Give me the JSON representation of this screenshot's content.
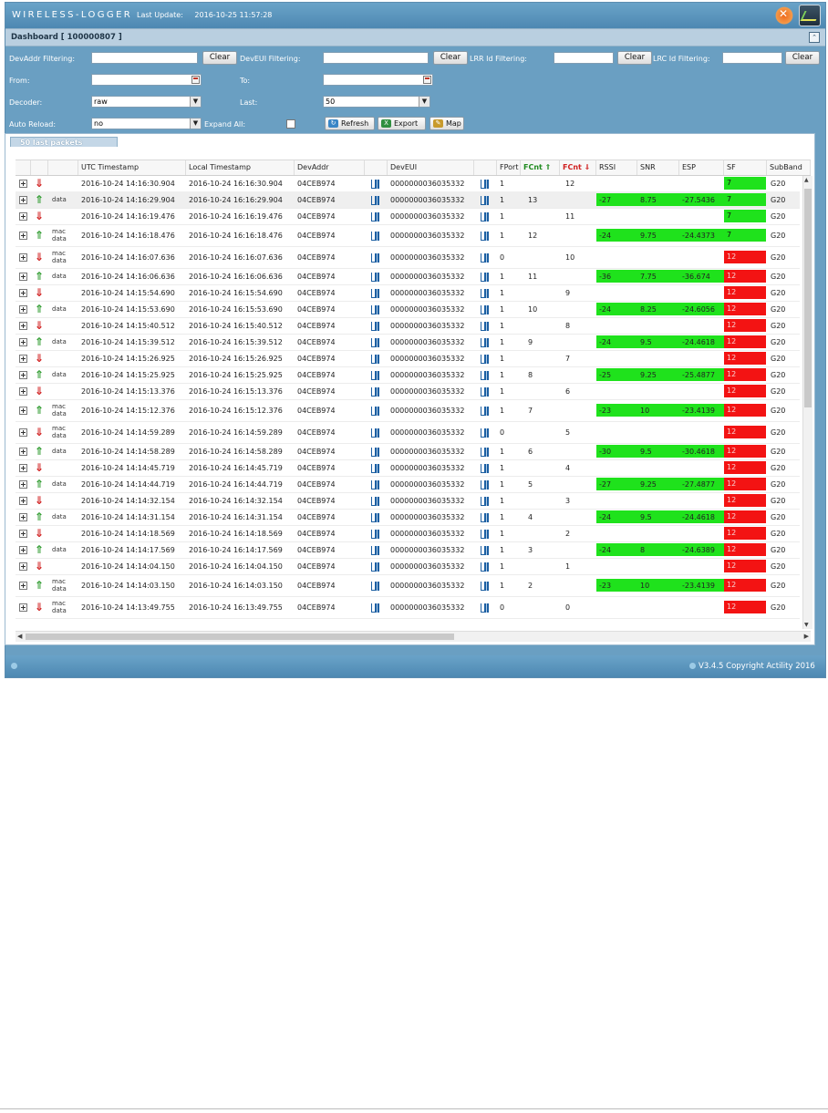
{
  "header": {
    "logo": "WIRELESS-LOGGER",
    "last_update_label": "Last Update:",
    "last_update_value": "2016-10-25 11:57:28"
  },
  "dashboard": {
    "title": "Dashboard [ 100000807 ]"
  },
  "filters": {
    "devaddr_label": "DevAddr Filtering:",
    "deveui_label": "DevEUI Filtering:",
    "lrr_label": "LRR Id Filtering:",
    "lrc_label": "LRC Id Filtering:",
    "clear_label": "Clear",
    "from_label": "From:",
    "to_label": "To:",
    "decoder_label": "Decoder:",
    "decoder_value": "raw",
    "last_label": "Last:",
    "last_value": "50",
    "autoreload_label": "Auto Reload:",
    "autoreload_value": "no",
    "expandall_label": "Expand All:",
    "refresh_label": "Refresh",
    "export_label": "Export",
    "map_label": "Map"
  },
  "panel": {
    "title": "50 last packets"
  },
  "columns": {
    "utc": "UTC Timestamp",
    "local": "Local Timestamp",
    "devaddr": "DevAddr",
    "deveui": "DevEUI",
    "fport": "FPort",
    "fcnt_up": "FCnt ⇑",
    "fcnt_dn": "FCnt ⇓",
    "rssi": "RSSI",
    "snr": "SNR",
    "esp": "ESP",
    "sf": "SF",
    "subband": "SubBand"
  },
  "colors": {
    "up_arrow": "#2e9b2e",
    "down_arrow": "#d01f1f",
    "good": "#1fe21c",
    "bad": "#f31313"
  },
  "rows": [
    {
      "dir": "down",
      "type": "",
      "utc": "2016-10-24 14:16:30.904",
      "local": "2016-10-24 16:16:30.904",
      "devaddr": "04CEB974",
      "deveui": "0000000036035332",
      "fport": "1",
      "fcnt_up": "",
      "fcnt_dn": "12",
      "rssi": "",
      "snr": "",
      "esp": "",
      "sf": "7",
      "subband": "G20"
    },
    {
      "dir": "up",
      "type": "data",
      "utc": "2016-10-24 14:16:29.904",
      "local": "2016-10-24 16:16:29.904",
      "devaddr": "04CEB974",
      "deveui": "0000000036035332",
      "fport": "1",
      "fcnt_up": "13",
      "fcnt_dn": "",
      "rssi": "-27",
      "snr": "8.75",
      "esp": "-27.5436",
      "sf": "7",
      "subband": "G20"
    },
    {
      "dir": "down",
      "type": "",
      "utc": "2016-10-24 14:16:19.476",
      "local": "2016-10-24 16:16:19.476",
      "devaddr": "04CEB974",
      "deveui": "0000000036035332",
      "fport": "1",
      "fcnt_up": "",
      "fcnt_dn": "11",
      "rssi": "",
      "snr": "",
      "esp": "",
      "sf": "7",
      "subband": "G20"
    },
    {
      "dir": "up",
      "type": "mac data",
      "utc": "2016-10-24 14:16:18.476",
      "local": "2016-10-24 16:16:18.476",
      "devaddr": "04CEB974",
      "deveui": "0000000036035332",
      "fport": "1",
      "fcnt_up": "12",
      "fcnt_dn": "",
      "rssi": "-24",
      "snr": "9.75",
      "esp": "-24.4373",
      "sf": "7",
      "subband": "G20"
    },
    {
      "dir": "down",
      "type": "mac data",
      "utc": "2016-10-24 14:16:07.636",
      "local": "2016-10-24 16:16:07.636",
      "devaddr": "04CEB974",
      "deveui": "0000000036035332",
      "fport": "0",
      "fcnt_up": "",
      "fcnt_dn": "10",
      "rssi": "",
      "snr": "",
      "esp": "",
      "sf": "12",
      "subband": "G20"
    },
    {
      "dir": "up",
      "type": "data",
      "utc": "2016-10-24 14:16:06.636",
      "local": "2016-10-24 16:16:06.636",
      "devaddr": "04CEB974",
      "deveui": "0000000036035332",
      "fport": "1",
      "fcnt_up": "11",
      "fcnt_dn": "",
      "rssi": "-36",
      "snr": "7.75",
      "esp": "-36.674",
      "sf": "12",
      "subband": "G20"
    },
    {
      "dir": "down",
      "type": "",
      "utc": "2016-10-24 14:15:54.690",
      "local": "2016-10-24 16:15:54.690",
      "devaddr": "04CEB974",
      "deveui": "0000000036035332",
      "fport": "1",
      "fcnt_up": "",
      "fcnt_dn": "9",
      "rssi": "",
      "snr": "",
      "esp": "",
      "sf": "12",
      "subband": "G20"
    },
    {
      "dir": "up",
      "type": "data",
      "utc": "2016-10-24 14:15:53.690",
      "local": "2016-10-24 16:15:53.690",
      "devaddr": "04CEB974",
      "deveui": "0000000036035332",
      "fport": "1",
      "fcnt_up": "10",
      "fcnt_dn": "",
      "rssi": "-24",
      "snr": "8.25",
      "esp": "-24.6056",
      "sf": "12",
      "subband": "G20"
    },
    {
      "dir": "down",
      "type": "",
      "utc": "2016-10-24 14:15:40.512",
      "local": "2016-10-24 16:15:40.512",
      "devaddr": "04CEB974",
      "deveui": "0000000036035332",
      "fport": "1",
      "fcnt_up": "",
      "fcnt_dn": "8",
      "rssi": "",
      "snr": "",
      "esp": "",
      "sf": "12",
      "subband": "G20"
    },
    {
      "dir": "up",
      "type": "data",
      "utc": "2016-10-24 14:15:39.512",
      "local": "2016-10-24 16:15:39.512",
      "devaddr": "04CEB974",
      "deveui": "0000000036035332",
      "fport": "1",
      "fcnt_up": "9",
      "fcnt_dn": "",
      "rssi": "-24",
      "snr": "9.5",
      "esp": "-24.4618",
      "sf": "12",
      "subband": "G20"
    },
    {
      "dir": "down",
      "type": "",
      "utc": "2016-10-24 14:15:26.925",
      "local": "2016-10-24 16:15:26.925",
      "devaddr": "04CEB974",
      "deveui": "0000000036035332",
      "fport": "1",
      "fcnt_up": "",
      "fcnt_dn": "7",
      "rssi": "",
      "snr": "",
      "esp": "",
      "sf": "12",
      "subband": "G20"
    },
    {
      "dir": "up",
      "type": "data",
      "utc": "2016-10-24 14:15:25.925",
      "local": "2016-10-24 16:15:25.925",
      "devaddr": "04CEB974",
      "deveui": "0000000036035332",
      "fport": "1",
      "fcnt_up": "8",
      "fcnt_dn": "",
      "rssi": "-25",
      "snr": "9.25",
      "esp": "-25.4877",
      "sf": "12",
      "subband": "G20"
    },
    {
      "dir": "down",
      "type": "",
      "utc": "2016-10-24 14:15:13.376",
      "local": "2016-10-24 16:15:13.376",
      "devaddr": "04CEB974",
      "deveui": "0000000036035332",
      "fport": "1",
      "fcnt_up": "",
      "fcnt_dn": "6",
      "rssi": "",
      "snr": "",
      "esp": "",
      "sf": "12",
      "subband": "G20"
    },
    {
      "dir": "up",
      "type": "mac data",
      "utc": "2016-10-24 14:15:12.376",
      "local": "2016-10-24 16:15:12.376",
      "devaddr": "04CEB974",
      "deveui": "0000000036035332",
      "fport": "1",
      "fcnt_up": "7",
      "fcnt_dn": "",
      "rssi": "-23",
      "snr": "10",
      "esp": "-23.4139",
      "sf": "12",
      "subband": "G20"
    },
    {
      "dir": "down",
      "type": "mac data",
      "utc": "2016-10-24 14:14:59.289",
      "local": "2016-10-24 16:14:59.289",
      "devaddr": "04CEB974",
      "deveui": "0000000036035332",
      "fport": "0",
      "fcnt_up": "",
      "fcnt_dn": "5",
      "rssi": "",
      "snr": "",
      "esp": "",
      "sf": "12",
      "subband": "G20"
    },
    {
      "dir": "up",
      "type": "data",
      "utc": "2016-10-24 14:14:58.289",
      "local": "2016-10-24 16:14:58.289",
      "devaddr": "04CEB974",
      "deveui": "0000000036035332",
      "fport": "1",
      "fcnt_up": "6",
      "fcnt_dn": "",
      "rssi": "-30",
      "snr": "9.5",
      "esp": "-30.4618",
      "sf": "12",
      "subband": "G20"
    },
    {
      "dir": "down",
      "type": "",
      "utc": "2016-10-24 14:14:45.719",
      "local": "2016-10-24 16:14:45.719",
      "devaddr": "04CEB974",
      "deveui": "0000000036035332",
      "fport": "1",
      "fcnt_up": "",
      "fcnt_dn": "4",
      "rssi": "",
      "snr": "",
      "esp": "",
      "sf": "12",
      "subband": "G20"
    },
    {
      "dir": "up",
      "type": "data",
      "utc": "2016-10-24 14:14:44.719",
      "local": "2016-10-24 16:14:44.719",
      "devaddr": "04CEB974",
      "deveui": "0000000036035332",
      "fport": "1",
      "fcnt_up": "5",
      "fcnt_dn": "",
      "rssi": "-27",
      "snr": "9.25",
      "esp": "-27.4877",
      "sf": "12",
      "subband": "G20"
    },
    {
      "dir": "down",
      "type": "",
      "utc": "2016-10-24 14:14:32.154",
      "local": "2016-10-24 16:14:32.154",
      "devaddr": "04CEB974",
      "deveui": "0000000036035332",
      "fport": "1",
      "fcnt_up": "",
      "fcnt_dn": "3",
      "rssi": "",
      "snr": "",
      "esp": "",
      "sf": "12",
      "subband": "G20"
    },
    {
      "dir": "up",
      "type": "data",
      "utc": "2016-10-24 14:14:31.154",
      "local": "2016-10-24 16:14:31.154",
      "devaddr": "04CEB974",
      "deveui": "0000000036035332",
      "fport": "1",
      "fcnt_up": "4",
      "fcnt_dn": "",
      "rssi": "-24",
      "snr": "9.5",
      "esp": "-24.4618",
      "sf": "12",
      "subband": "G20"
    },
    {
      "dir": "down",
      "type": "",
      "utc": "2016-10-24 14:14:18.569",
      "local": "2016-10-24 16:14:18.569",
      "devaddr": "04CEB974",
      "deveui": "0000000036035332",
      "fport": "1",
      "fcnt_up": "",
      "fcnt_dn": "2",
      "rssi": "",
      "snr": "",
      "esp": "",
      "sf": "12",
      "subband": "G20"
    },
    {
      "dir": "up",
      "type": "data",
      "utc": "2016-10-24 14:14:17.569",
      "local": "2016-10-24 16:14:17.569",
      "devaddr": "04CEB974",
      "deveui": "0000000036035332",
      "fport": "1",
      "fcnt_up": "3",
      "fcnt_dn": "",
      "rssi": "-24",
      "snr": "8",
      "esp": "-24.6389",
      "sf": "12",
      "subband": "G20"
    },
    {
      "dir": "down",
      "type": "",
      "utc": "2016-10-24 14:14:04.150",
      "local": "2016-10-24 16:14:04.150",
      "devaddr": "04CEB974",
      "deveui": "0000000036035332",
      "fport": "1",
      "fcnt_up": "",
      "fcnt_dn": "1",
      "rssi": "",
      "snr": "",
      "esp": "",
      "sf": "12",
      "subband": "G20"
    },
    {
      "dir": "up",
      "type": "mac data",
      "utc": "2016-10-24 14:14:03.150",
      "local": "2016-10-24 16:14:03.150",
      "devaddr": "04CEB974",
      "deveui": "0000000036035332",
      "fport": "1",
      "fcnt_up": "2",
      "fcnt_dn": "",
      "rssi": "-23",
      "snr": "10",
      "esp": "-23.4139",
      "sf": "12",
      "subband": "G20"
    },
    {
      "dir": "down",
      "type": "mac data",
      "utc": "2016-10-24 14:13:49.755",
      "local": "2016-10-24 16:13:49.755",
      "devaddr": "04CEB974",
      "deveui": "0000000036035332",
      "fport": "0",
      "fcnt_up": "",
      "fcnt_dn": "0",
      "rssi": "",
      "snr": "",
      "esp": "",
      "sf": "12",
      "subband": "G20"
    }
  ],
  "footer": {
    "version": "V3.4.5",
    "copyright": "Copyright Actility 2016"
  }
}
